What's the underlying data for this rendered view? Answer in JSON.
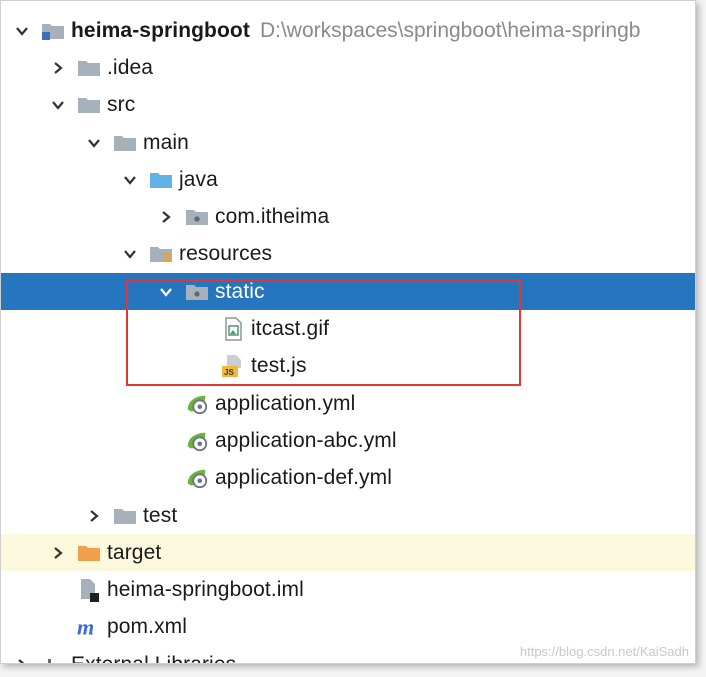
{
  "project": {
    "name": "heima-springboot",
    "path": "D:\\workspaces\\springboot\\heima-springb"
  },
  "tree": [
    {
      "label": "heima-springboot",
      "icon": "module-folder-icon",
      "arrow": "down",
      "indent": 0
    },
    {
      "label": ".idea",
      "icon": "folder-icon",
      "arrow": "right",
      "indent": 1
    },
    {
      "label": "src",
      "icon": "folder-icon",
      "arrow": "down",
      "indent": 1
    },
    {
      "label": "main",
      "icon": "folder-icon",
      "arrow": "down",
      "indent": 2
    },
    {
      "label": "java",
      "icon": "source-folder-icon",
      "arrow": "down",
      "indent": 3
    },
    {
      "label": "com.itheima",
      "icon": "package-icon",
      "arrow": "right",
      "indent": 4
    },
    {
      "label": "resources",
      "icon": "resources-folder-icon",
      "arrow": "down",
      "indent": 3
    },
    {
      "label": "static",
      "icon": "package-icon",
      "arrow": "down",
      "indent": 4
    },
    {
      "label": "itcast.gif",
      "icon": "image-file-icon",
      "arrow": "none",
      "indent": 5
    },
    {
      "label": "test.js",
      "icon": "js-file-icon",
      "arrow": "none",
      "indent": 5
    },
    {
      "label": "application.yml",
      "icon": "spring-yml-icon",
      "arrow": "none",
      "indent": 4
    },
    {
      "label": "application-abc.yml",
      "icon": "spring-yml-icon",
      "arrow": "none",
      "indent": 4
    },
    {
      "label": "application-def.yml",
      "icon": "spring-yml-icon",
      "arrow": "none",
      "indent": 4
    },
    {
      "label": "test",
      "icon": "folder-icon",
      "arrow": "right",
      "indent": 2
    },
    {
      "label": "target",
      "icon": "excluded-folder-icon",
      "arrow": "right",
      "indent": 1
    },
    {
      "label": "heima-springboot.iml",
      "icon": "iml-file-icon",
      "arrow": "none",
      "indent": 1
    },
    {
      "label": "pom.xml",
      "icon": "maven-icon",
      "arrow": "none",
      "indent": 1
    },
    {
      "label": "External Libraries",
      "icon": "libraries-icon",
      "arrow": "right",
      "indent": 0
    }
  ],
  "selected_label": "static",
  "highlighted_label": "target",
  "watermark": "https://blog.csdn.net/KaiSadh",
  "colors": {
    "selection": "#2675bf",
    "highlight": "#fbf8dd",
    "annotation_box": "#e53535",
    "folder": "#a7b1bb",
    "source_folder": "#5fb3e7",
    "excluded_folder": "#f0a04b"
  }
}
